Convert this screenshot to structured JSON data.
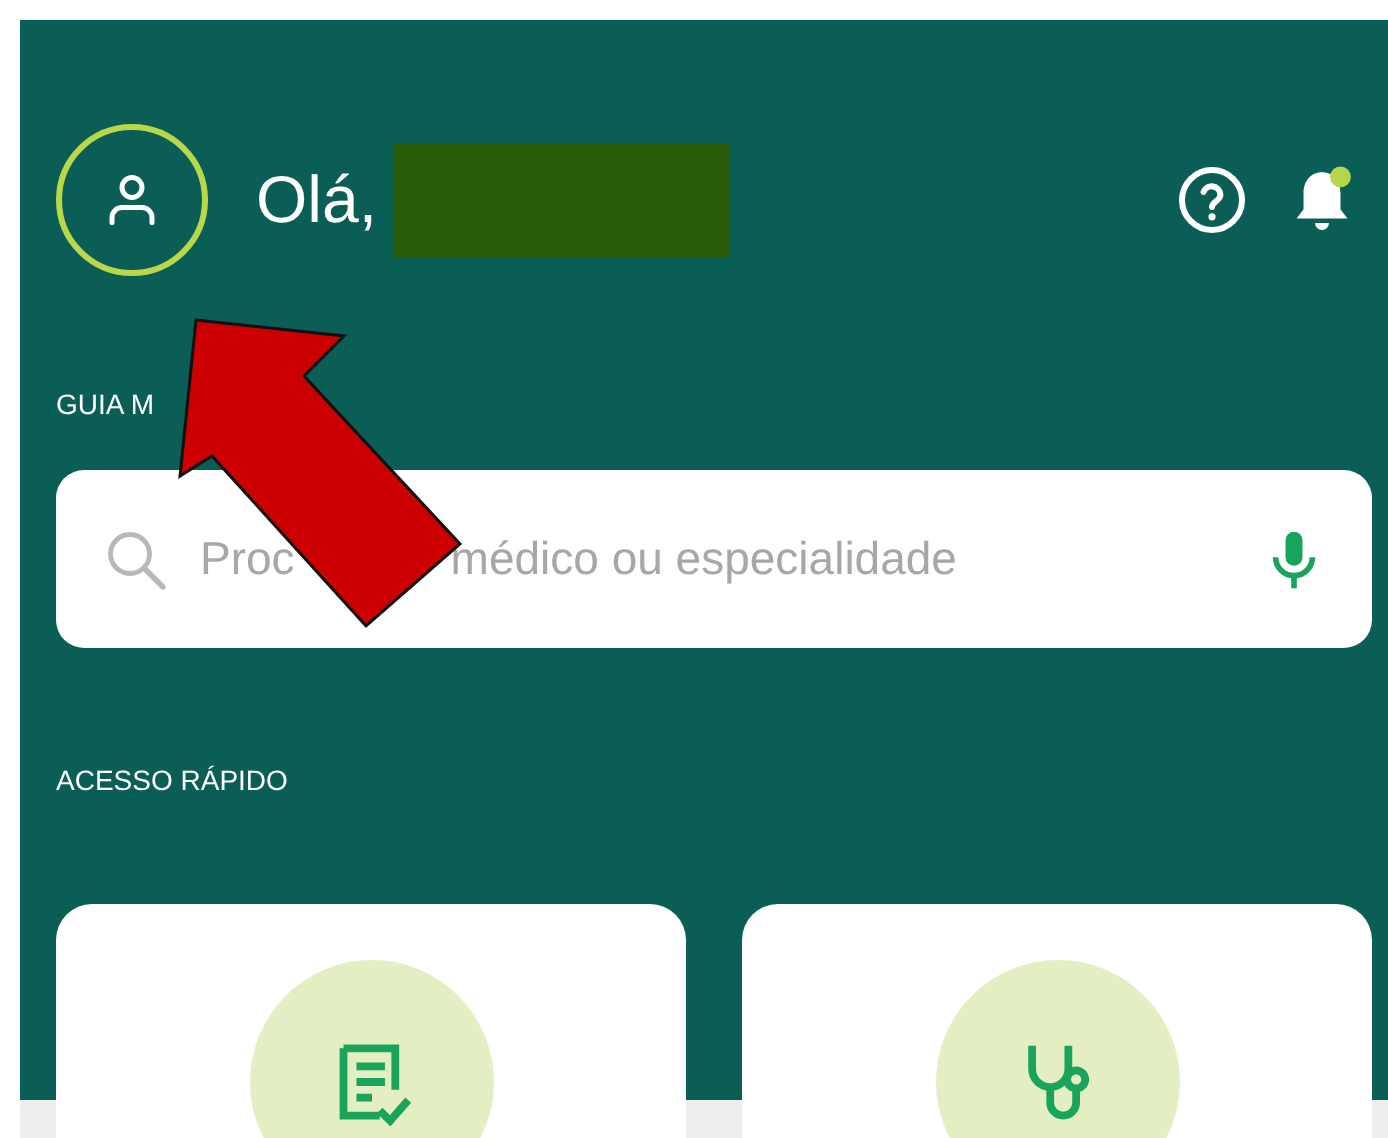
{
  "header": {
    "greeting": "Olá,",
    "name_redacted": true,
    "notifications_unread": true
  },
  "guide": {
    "label": "GUIA M",
    "search": {
      "placeholder_parts": [
        "Proc",
        "médico ou especialidade"
      ]
    }
  },
  "quick_access": {
    "label": "ACESSO RÁPIDO",
    "cards": [
      {
        "kind": "checklist"
      },
      {
        "kind": "stethoscope"
      }
    ]
  },
  "annotation_arrow": true
}
